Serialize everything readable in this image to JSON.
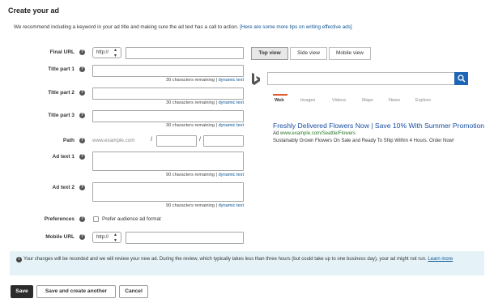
{
  "page": {
    "title": "Create your ad",
    "intro_text": "We recommend including a keyword in your ad title and making sure the ad text has a call to action.",
    "intro_link": "[Here are some more tips on writing effective ads]"
  },
  "help_glyph": "?",
  "form": {
    "final_url": {
      "label": "Final URL",
      "protocol": "http://",
      "value": ""
    },
    "title1": {
      "label": "Title part 1",
      "value": "",
      "remaining": "30 characters remaining",
      "sep": "|",
      "dynamic": "dynamic text"
    },
    "title2": {
      "label": "Title part 2",
      "value": "",
      "remaining": "30 characters remaining",
      "sep": "|",
      "dynamic": "dynamic text"
    },
    "title3": {
      "label": "Title part 3",
      "value": "",
      "remaining": "30 characters remaining",
      "sep": "|",
      "dynamic": "dynamic text"
    },
    "path": {
      "label": "Path",
      "prefix": "www.example.com",
      "slash": "/",
      "path1": "",
      "path2": ""
    },
    "adtext1": {
      "label": "Ad text 1",
      "value": "",
      "remaining": "90 characters remaining",
      "sep": "|",
      "dynamic": "dynamic text"
    },
    "adtext2": {
      "label": "Ad text 2",
      "value": "",
      "remaining": "90 characters remaining",
      "sep": "|",
      "dynamic": "dynamic text"
    },
    "preferences": {
      "label": "Preferences",
      "option": "Prefer audience ad format",
      "checked": false
    },
    "mobile_url": {
      "label": "Mobile URL",
      "protocol": "http://",
      "value": ""
    }
  },
  "preview": {
    "tabs": [
      "Top view",
      "Side view",
      "Mobile view"
    ],
    "active_tab": "Top view",
    "search_tabs": [
      "Web",
      "Images",
      "Videos",
      "Maps",
      "News",
      "Explore"
    ],
    "active_search_tab": "Web",
    "ad": {
      "title": "Freshly Delivered Flowers Now | Save 10% With Summer Promotion",
      "badge": "Ad",
      "url": "www.example.com/Seattle/Flowers",
      "description": "Sustainably Grown Flowers On Sale and Ready To Ship Within 4 Hours. Order Now!"
    },
    "colors": {
      "ad_title": "#1a4fa0",
      "ad_url": "#2a7a2a",
      "search_button": "#1e66b5",
      "active_underline": "#e05a2b"
    }
  },
  "notice": {
    "text": "Your changes will be recorded and we will review your new ad. During the review, which typically takes less than three hours (but could take up to one business day), your ad might not run.",
    "link": "Learn more"
  },
  "actions": {
    "save": "Save",
    "save_another": "Save and create another",
    "cancel": "Cancel"
  },
  "icons": {
    "help": "question-circle-icon",
    "info": "info-circle-icon",
    "search": "magnifier-icon",
    "logo": "bing-logo"
  }
}
